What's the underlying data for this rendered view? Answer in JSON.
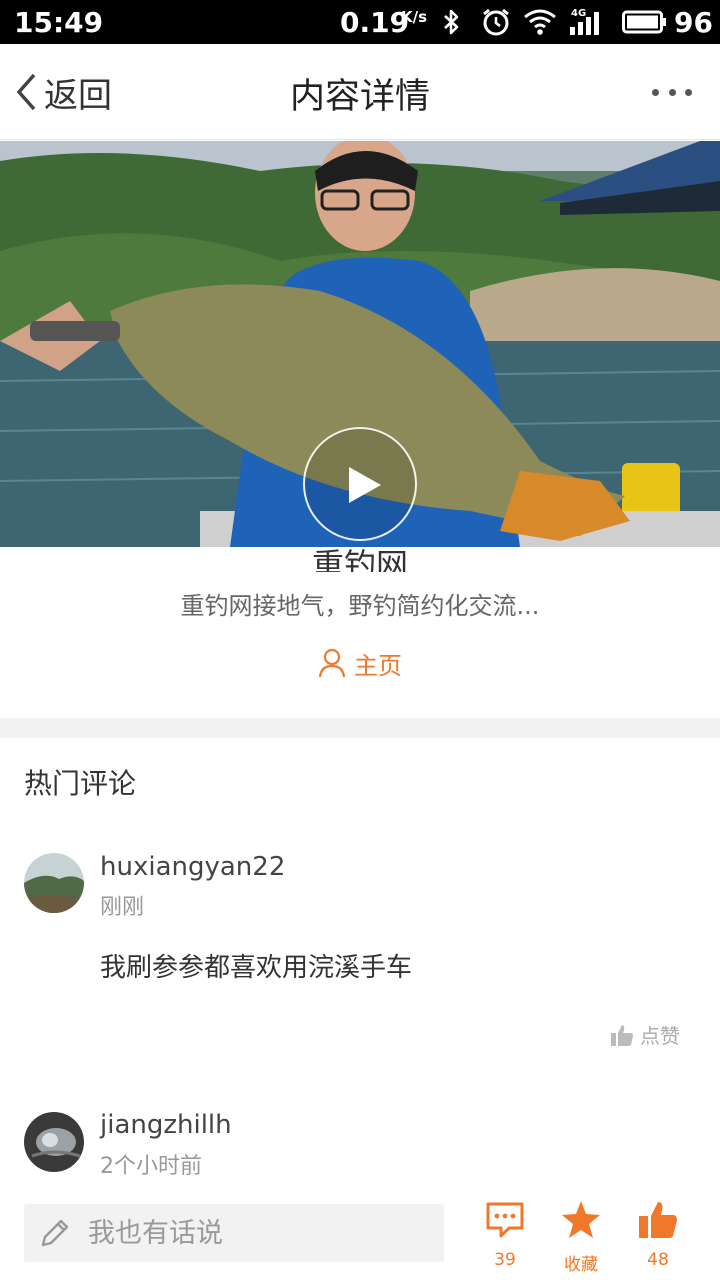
{
  "status_bar": {
    "time": "15:49",
    "speed": "0.19",
    "speed_unit": "K/s",
    "network": "4G",
    "battery": "96",
    "icons": [
      "bluetooth-icon",
      "alarm-icon",
      "wifi-icon",
      "signal-icon",
      "battery-icon"
    ]
  },
  "header": {
    "back_label": "返回",
    "title": "内容详情",
    "more_icon": "more-icon"
  },
  "video": {
    "play_icon": "play-icon"
  },
  "channel": {
    "name": "重钓网",
    "description": "重钓网接地气，野钓简约化交流...",
    "homepage_label": "主页"
  },
  "comments": {
    "section_title": "热门评论",
    "items": [
      {
        "user": "huxiangyan22",
        "time": "刚刚",
        "text": "我刷参参都喜欢用浣溪手车",
        "like_label": "点赞"
      },
      {
        "user": "jiangzhillh",
        "time": "2个小时前"
      }
    ]
  },
  "bottom_bar": {
    "input_placeholder": "我也有话说",
    "comment_count": "39",
    "favorite_label": "收藏",
    "like_count": "48"
  },
  "colors": {
    "accent": "#f0782a",
    "status_bar_bg": "#000000",
    "divider_bg": "#f2f2f2",
    "input_bg": "#f2f2f2"
  }
}
